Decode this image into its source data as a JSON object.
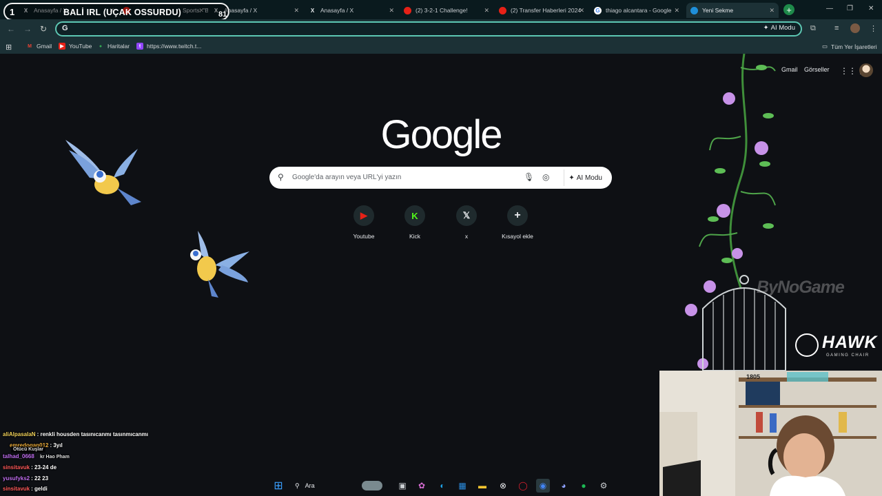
{
  "overlay": {
    "number": "1",
    "title": "BALİ IRL (UÇAK OSSURDU)",
    "count": "81"
  },
  "tabs": [
    {
      "label": "Anasayfa / X",
      "icon": "x-logo-icon"
    },
    {
      "label": "Sports: \"Be",
      "icon": "youtube-icon"
    },
    {
      "label": "Anasayfa / X",
      "icon": "x-logo-icon"
    },
    {
      "label": "Anasayfa / X",
      "icon": "x-logo-icon"
    },
    {
      "label": "(2) 3-2-1 Challenge!",
      "icon": "youtube-icon"
    },
    {
      "label": "(2) Transfer Haberleri 2024",
      "icon": "youtube-icon"
    },
    {
      "label": "thiago alcantara - Google",
      "icon": "google-icon"
    },
    {
      "label": "Yeni Sekme",
      "icon": "chrome-icon"
    }
  ],
  "toolbar": {
    "omnibox_prefix": "G",
    "ai_mode": "AI Modu"
  },
  "bookmarks": {
    "items": [
      {
        "label": "Gmail",
        "icon": "gmail-icon"
      },
      {
        "label": "YouTube",
        "icon": "youtube-icon"
      },
      {
        "label": "Haritalar",
        "icon": "maps-icon"
      },
      {
        "label": "https://www.twitch.t...",
        "icon": "twitch-icon"
      }
    ],
    "all_bookmarks": "Tüm Yer İşaretleri"
  },
  "page": {
    "logo": "Google",
    "search_placeholder": "Google'da arayın veya URL'yi yazın",
    "ai_mode": "AI Modu",
    "top_links": {
      "gmail": "Gmail",
      "images": "Görseller"
    },
    "shortcuts": [
      {
        "label": "Youtube",
        "glyph": "▶",
        "color": "#e62117"
      },
      {
        "label": "Kick",
        "glyph": "K",
        "color": "#53fc18"
      },
      {
        "label": "x",
        "glyph": "𝕏",
        "color": "#e8eaed"
      },
      {
        "label": "Kısayol ekle",
        "glyph": "+",
        "color": "#e8eaed"
      }
    ]
  },
  "sponsors": {
    "bynogame": "ByNoGame",
    "hawk": "HAWK",
    "hawk_sub": "GAMING CHAIR"
  },
  "chat": [
    {
      "user": "aliAlpasalaN",
      "user_color": "#f2d35b",
      "msg": ": renkli housden tasınıcanmı tasınmıcanmı"
    },
    {
      "user": "emredogan012",
      "user_color": "#f2b13b",
      "msg": ": 3yıl"
    },
    {
      "user": "talhad_0668",
      "user_color": "#c06ef0",
      "msg": ""
    },
    {
      "user": "sinsitavuk",
      "user_color": "#ff5a5a",
      "msg": ": 23-24 de"
    },
    {
      "user": "yusufyks2",
      "user_color": "#c06ef0",
      "msg": ": 22 23"
    },
    {
      "user": "sinsitavuk",
      "user_color": "#ff5a5a",
      "msg": ": geldi"
    }
  ],
  "chat_overlay": {
    "label1": "Ötücü Kuşlar",
    "label2": "kr Hao Pham"
  },
  "taskbar": {
    "search_label": "Ara"
  },
  "webcam": {
    "poster_number": "1805"
  }
}
